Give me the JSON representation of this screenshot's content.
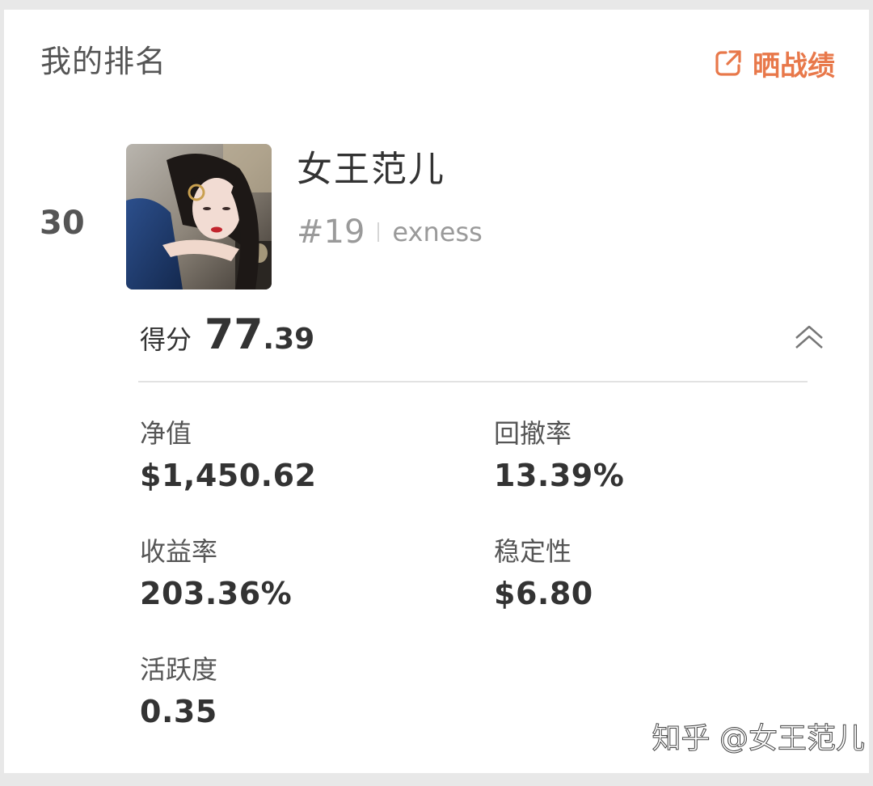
{
  "header": {
    "title": "我的排名",
    "share_label": "晒战绩"
  },
  "user": {
    "rank": "30",
    "name": "女王范儿",
    "id": "#19",
    "broker": "exness"
  },
  "score": {
    "label": "得分",
    "integer": "77",
    "decimal": ".39"
  },
  "stats": {
    "net_value": {
      "label": "净值",
      "value": "$1,450.62"
    },
    "drawdown": {
      "label": "回撤率",
      "value": "13.39%"
    },
    "return_rate": {
      "label": "收益率",
      "value": "203.36%"
    },
    "stability": {
      "label": "稳定性",
      "value": "$6.80"
    },
    "activity": {
      "label": "活跃度",
      "value": "0.35"
    }
  },
  "watermark": "知乎 @女王范儿",
  "colors": {
    "accent": "#e8784a",
    "text_primary": "#333333",
    "text_secondary": "#555555",
    "text_muted": "#9a9a9a"
  },
  "icons": {
    "share": "share-external-icon",
    "collapse": "double-chevron-up-icon"
  }
}
